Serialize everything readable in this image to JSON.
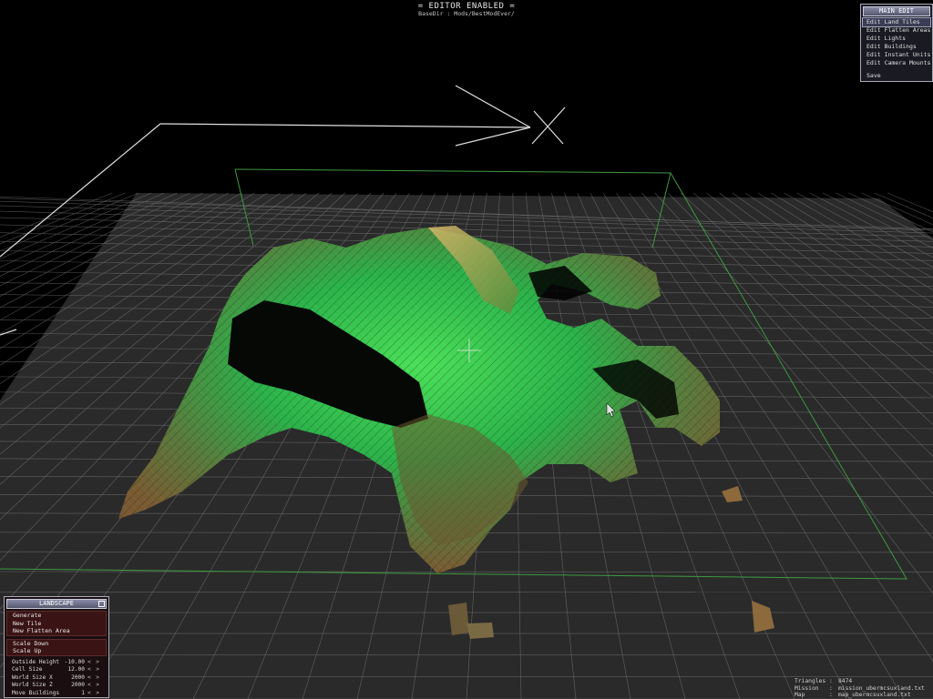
{
  "header": {
    "title": "= EDITOR ENABLED =",
    "subtitle": "BaseDir : Mods/BestModEver/"
  },
  "main_edit": {
    "title": "MAIN EDIT",
    "items": [
      {
        "label": "Edit Land Tiles",
        "selected": true
      },
      {
        "label": "Edit Flatten Areas",
        "selected": false
      },
      {
        "label": "Edit Lights",
        "selected": false
      },
      {
        "label": "Edit Buildings",
        "selected": false
      },
      {
        "label": "Edit Instant Units",
        "selected": false
      },
      {
        "label": "Edit Camera Mounts",
        "selected": false
      }
    ],
    "save_label": "Save"
  },
  "landscape": {
    "title": "LANDSCAPE",
    "buttons_group1": [
      "Generate",
      "New Tile",
      "New Flatten Area"
    ],
    "buttons_group2": [
      "Scale Down",
      "Scale Up"
    ],
    "params": [
      {
        "label": "Outside Height",
        "value": "-10.00"
      },
      {
        "label": "Cell Size",
        "value": "12.00"
      },
      {
        "label": "World Size X",
        "value": "2000"
      },
      {
        "label": "World Size Z",
        "value": "2000"
      },
      {
        "label": "Move Buildings",
        "value": "1"
      }
    ],
    "stepper_left": "<",
    "stepper_right": ">"
  },
  "info": {
    "triangles_label": "Triangles",
    "triangles_value": "8474",
    "mission_label": "Mission",
    "mission_value": "mission_ubermcsuxland.txt",
    "map_label": "Map",
    "map_value": "map_ubermcsuxland.txt",
    "separator": ":"
  },
  "colors": {
    "grid": "#8f8f8f",
    "terrain_green": "#2fd14a",
    "terrain_brown": "#8c6a3c",
    "bounds_green": "#3f9a40",
    "panel_border": "#a9aab8",
    "landscape_button_bg": "#3a1415"
  }
}
